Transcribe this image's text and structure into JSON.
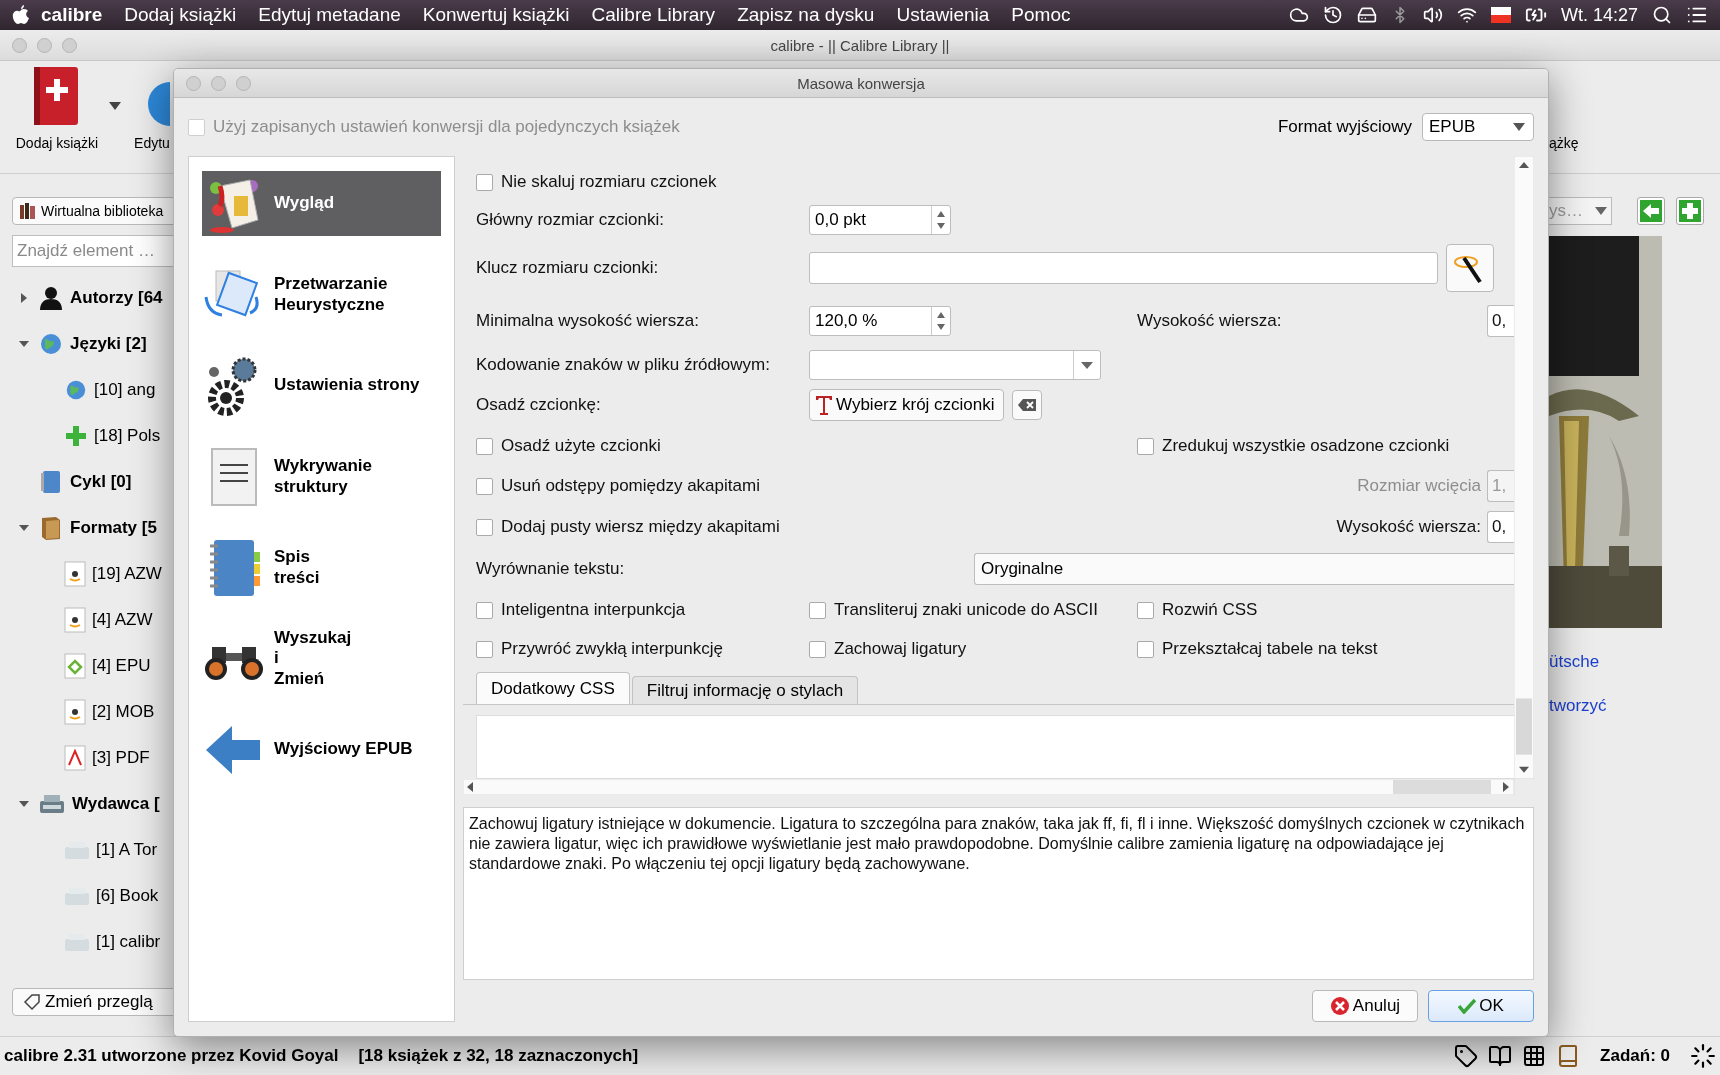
{
  "menubar": {
    "app": "calibre",
    "menus": [
      "Dodaj książki",
      "Edytuj metadane",
      "Konwertuj książki",
      "Calibre Library",
      "Zapisz na dysku",
      "Ustawienia",
      "Pomoc"
    ],
    "clock": "Wt. 14:27"
  },
  "window": {
    "title": "calibre - || Calibre Library ||"
  },
  "toolbar": {
    "left": [
      {
        "label": "Dodaj książki"
      },
      {
        "label": "Edytu"
      }
    ],
    "right_label": "ążkę"
  },
  "library": {
    "virtual_button": "Wirtualna biblioteka",
    "search": {
      "placeholder": "Znajdź element …"
    },
    "tree": [
      {
        "label": "Autorzy [64",
        "expanded": false
      },
      {
        "label": "Języki [2]",
        "expanded": true,
        "children": [
          {
            "label": "[10] ang"
          },
          {
            "label": "[18] Pols"
          }
        ]
      },
      {
        "label": "Cykl [0]"
      },
      {
        "label": "Formaty [5",
        "expanded": true,
        "children": [
          {
            "label": "[19] AZW"
          },
          {
            "label": "[4] AZW"
          },
          {
            "label": "[4] EPU"
          },
          {
            "label": "[2] MOB"
          },
          {
            "label": "[3] PDF"
          }
        ]
      },
      {
        "label": "Wydawca [",
        "expanded": true,
        "children": [
          {
            "label": "[1] A Tor"
          },
          {
            "label": "[6] Book"
          },
          {
            "label": "[1] calibr"
          }
        ]
      }
    ],
    "view_button": "Zmień przeglą"
  },
  "details": {
    "combo": "ys…",
    "links": [
      "ütsche",
      "tworzyć"
    ]
  },
  "status_bar": {
    "left": "calibre 2.31 utworzone przez Kovid Goyal",
    "selection": "[18 książek z 32, 18 zaznaczonych]",
    "jobs": "Zadań: 0"
  },
  "dialog": {
    "title": "Masowa konwersja",
    "use_saved": {
      "label": "Użyj zapisanych ustawień konwersji dla pojedynczych książek",
      "checked": false,
      "disabled": true
    },
    "output_format": {
      "label": "Format wyjściowy",
      "value": "EPUB"
    },
    "sections": [
      {
        "label": "Wygląd",
        "selected": true
      },
      {
        "label": "Przetwarzanie\nHeurystyczne",
        "selected": false
      },
      {
        "label": "Ustawienia strony",
        "selected": false
      },
      {
        "label": "Wykrywanie\nstruktury",
        "selected": false
      },
      {
        "label": "Spis\ntreści",
        "selected": false
      },
      {
        "label": "Wyszukaj\ni\nZmień",
        "selected": false
      },
      {
        "label": "Wyjściowy EPUB",
        "selected": false
      }
    ],
    "form": {
      "rows": [
        {
          "kind": "checkbox",
          "label": "Nie skaluj rozmiaru czcionek",
          "checked": false
        },
        {
          "kind": "spin",
          "label": "Główny rozmiar czcionki:",
          "value": "0,0 pkt"
        },
        {
          "kind": "key",
          "label": "Klucz rozmiaru czcionki:"
        },
        {
          "kind": "spin",
          "label": "Minimalna wysokość wiersza:",
          "value": "120,0 %",
          "right_label": "Wysokość wiersza:",
          "right_value": "0,"
        },
        {
          "kind": "combo",
          "label": "Kodowanie znaków w pliku źródłowym:"
        },
        {
          "kind": "font",
          "label": "Osadź czcionkę:",
          "button": "Wybierz krój czcionki"
        },
        {
          "kind": "checks",
          "checks": [
            {
              "label": "Osadź użyte czcionki",
              "checked": false
            },
            {
              "label": "Zredukuj wszystkie osadzone czcionki",
              "checked": false
            }
          ]
        },
        {
          "kind": "check_field",
          "check": {
            "label": "Usuń odstępy pomiędzy akapitami",
            "checked": false
          },
          "right_label": "Rozmiar wcięcia",
          "right_value": "1,",
          "right_disabled": true
        },
        {
          "kind": "check_field",
          "check": {
            "label": "Dodaj pusty wiersz między akapitami",
            "checked": false
          },
          "right_label": "Wysokość wiersza:",
          "right_value": "0,",
          "right_disabled": false
        },
        {
          "kind": "select",
          "label": "Wyrównanie tekstu:",
          "value": "Oryginalne"
        },
        {
          "kind": "checks",
          "checks": [
            {
              "label": "Inteligentna interpunkcja",
              "checked": false
            },
            {
              "label": "Transliteruj znaki unicode do ASCII",
              "checked": false
            },
            {
              "label": "Rozwiń CSS",
              "checked": false
            }
          ]
        },
        {
          "kind": "checks",
          "checks": [
            {
              "label": "Przywróć zwykłą interpunkcję",
              "checked": false
            },
            {
              "label": "Zachowaj ligatury",
              "checked": false
            },
            {
              "label": "Przekształcaj tabele na tekst",
              "checked": false
            }
          ]
        }
      ],
      "tabs": [
        {
          "label": "Dodatkowy CSS",
          "selected": true
        },
        {
          "label": "Filtruj informację o stylach",
          "selected": false
        }
      ]
    },
    "description": "Zachowuj ligatury istniejące w dokumencie. Ligatura to szczególna para znaków, taka jak ff, fi, fl i inne. Większość domyślnych czcionek w czytnikach nie zawiera ligatur, więc ich prawidłowe wyświetlanie jest mało prawdopodobne. Domyślnie calibre zamienia ligaturę na odpowiadające jej standardowe znaki. Po włączeniu tej opcji ligatury będą zachowywane.",
    "buttons": [
      {
        "kind": "cancel",
        "label": "Anuluj"
      },
      {
        "kind": "ok",
        "label": "OK"
      }
    ]
  }
}
